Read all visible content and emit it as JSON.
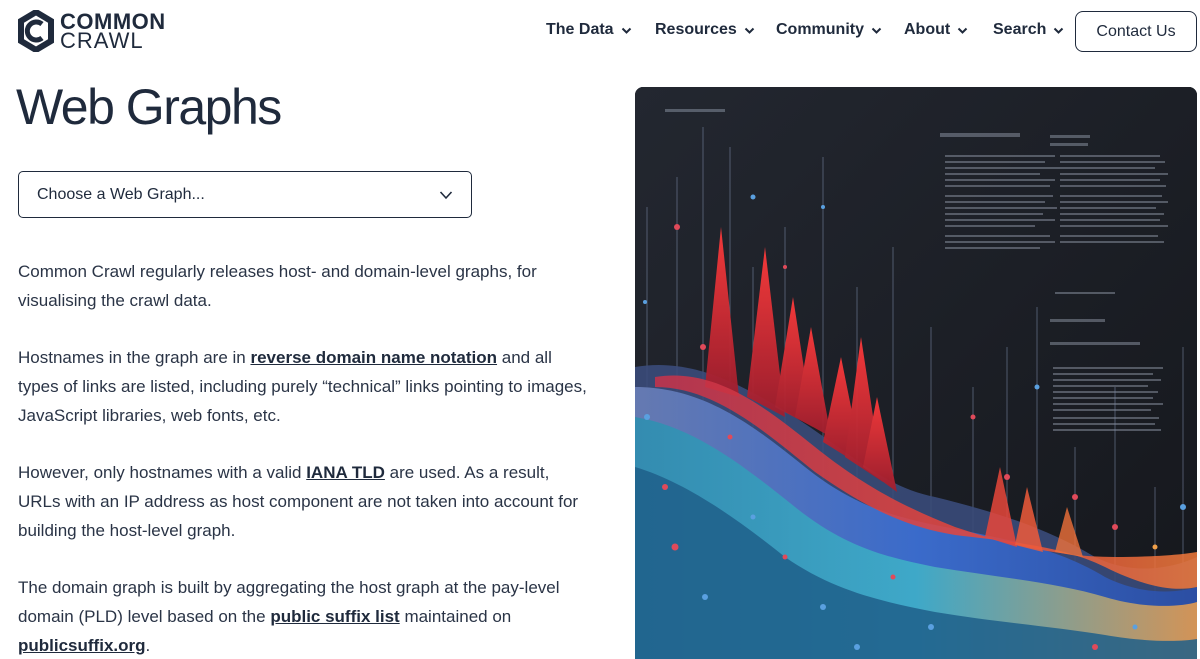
{
  "brand": {
    "line1": "COMMON",
    "line2": "CRAWL"
  },
  "nav": {
    "items": [
      {
        "label": "The Data"
      },
      {
        "label": "Resources"
      },
      {
        "label": "Community"
      },
      {
        "label": "About"
      },
      {
        "label": "Search"
      }
    ],
    "contact_label": "Contact Us"
  },
  "main": {
    "title": "Web Graphs",
    "select": {
      "value": "Choose a Web Graph..."
    },
    "paragraphs": [
      {
        "text1": "Common Crawl regularly releases host- and domain-level graphs, for visualising the crawl data."
      },
      {
        "text1": "Hostnames in the graph are in ",
        "link1": "reverse domain name notation",
        "text2": " and all types of links are listed, including purely “technical” links pointing to images, JavaScript libraries, web fonts, etc."
      },
      {
        "text1": "However, only hostnames with a valid ",
        "link1": "IANA TLD",
        "text2": " are used. As a result, URLs with an IP address as host component are not taken into account for building the host-level graph."
      },
      {
        "text1": "The domain graph is built by aggregating the host graph at the pay-level domain (PLD) level based on the ",
        "link1": "public suffix list",
        "text2": " maintained on ",
        "link2": "publicsuffix.org",
        "text3": "."
      }
    ]
  },
  "colors": {
    "text": "#1f2a3c",
    "hero_bg": "#1a1d23",
    "accent_red": "#e0393e",
    "accent_blue": "#3a6fd8"
  }
}
